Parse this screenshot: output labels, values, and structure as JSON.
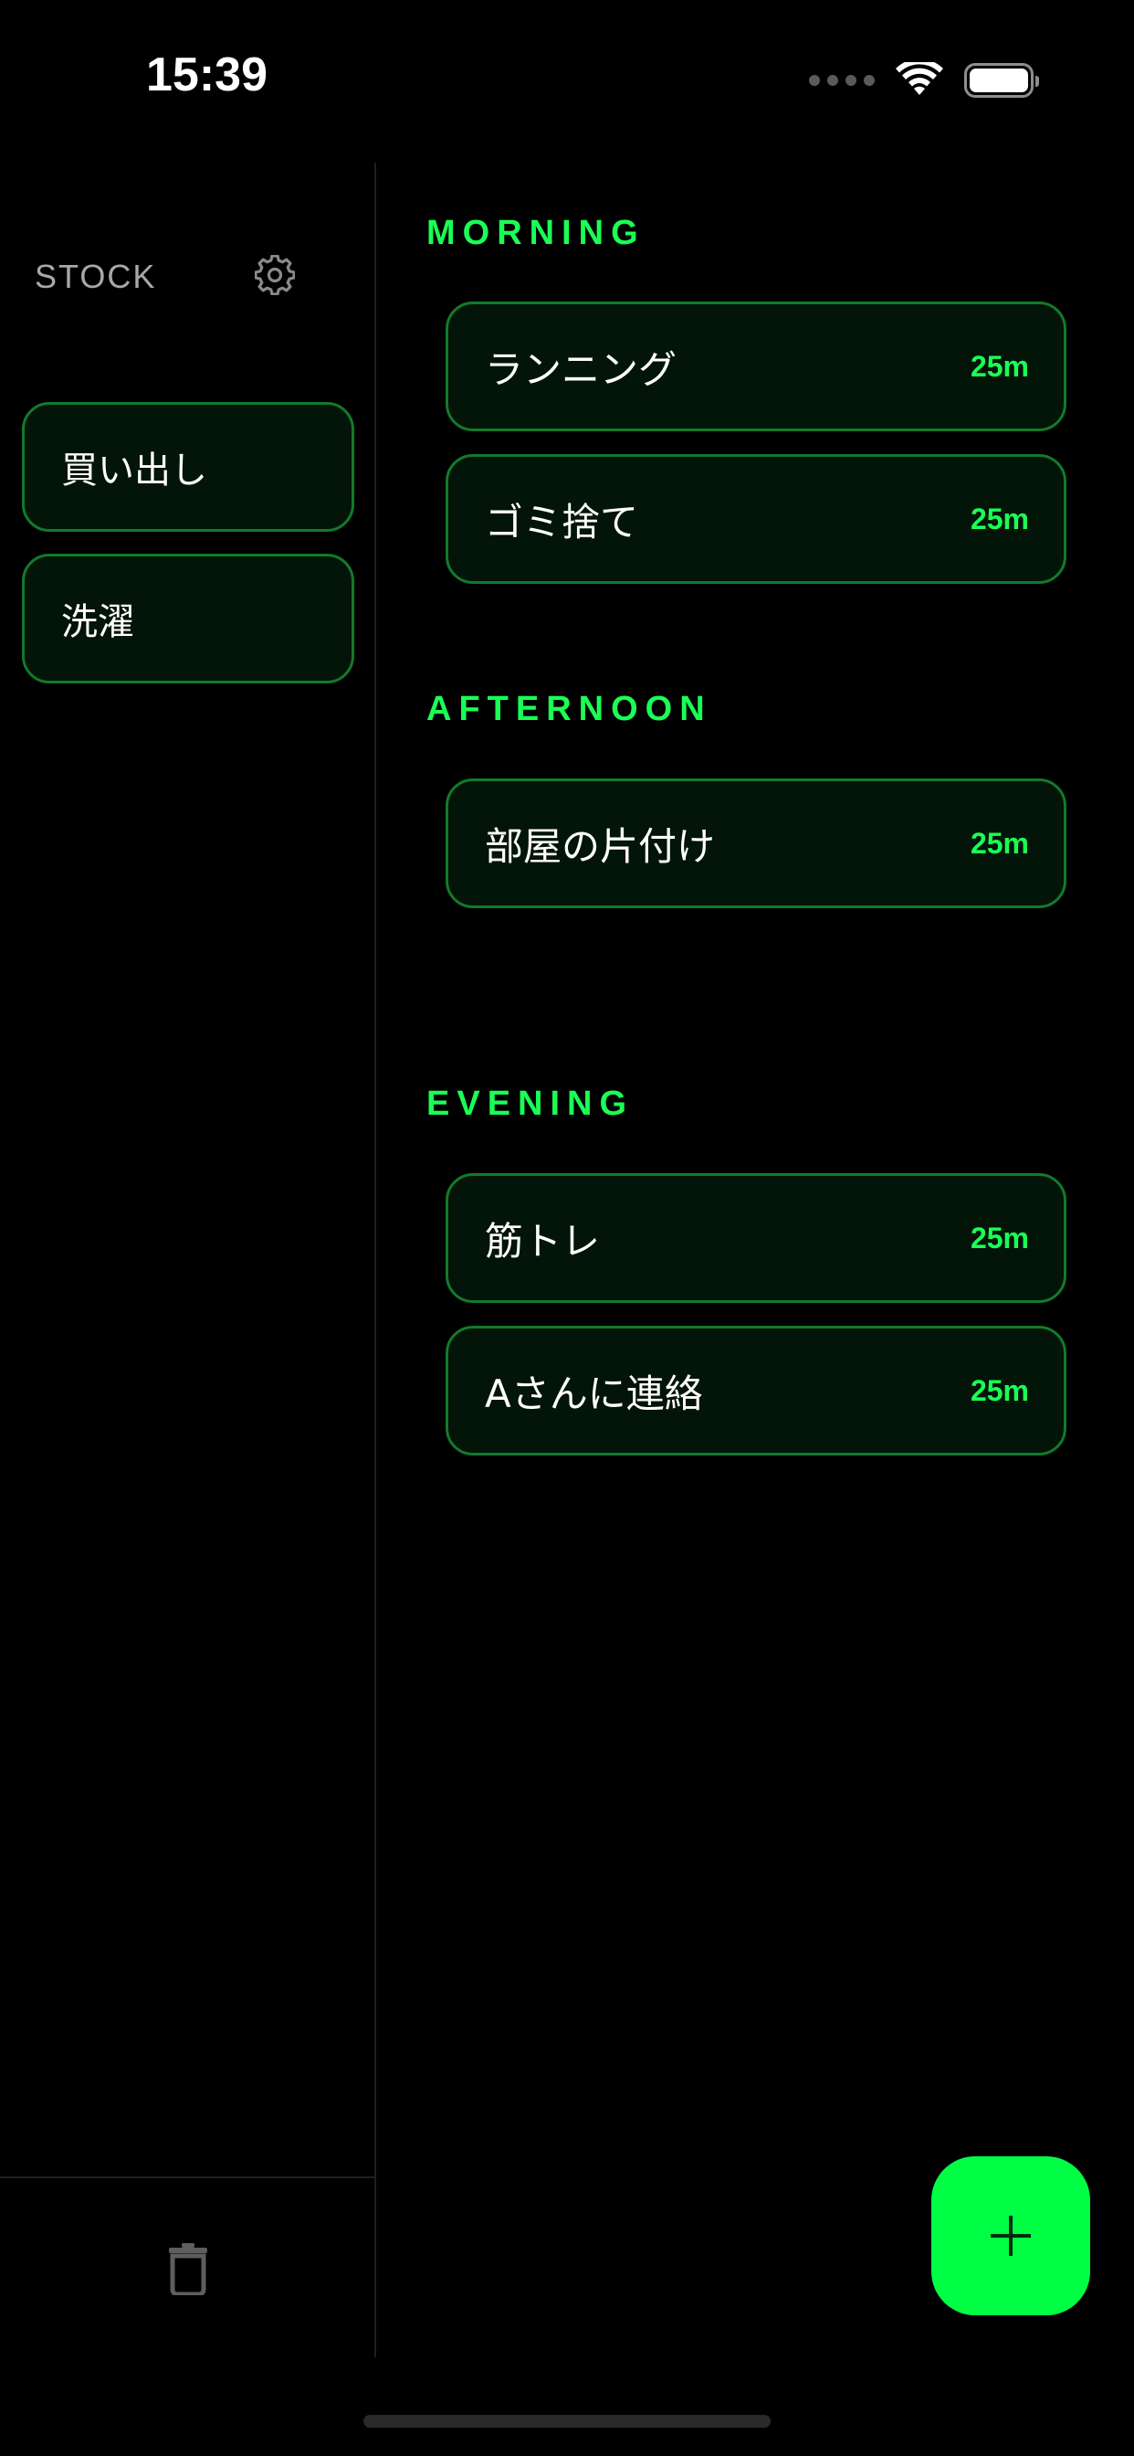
{
  "status_bar": {
    "time": "15:39",
    "icons": [
      "cellular-dots-icon",
      "wifi-icon",
      "battery-icon"
    ]
  },
  "colors": {
    "background": "#000000",
    "accent_green": "#1aff55",
    "fab_green": "#00ff44",
    "card_border": "#127a2c",
    "card_fill": "#031408",
    "muted_text": "#a8a8a8"
  },
  "sidebar": {
    "title": "STOCK",
    "settings_icon": "gear-icon",
    "items": [
      {
        "label": "買い出し"
      },
      {
        "label": "洗濯"
      }
    ],
    "trash_icon": "trash-icon"
  },
  "schedule": {
    "sections": [
      {
        "title": "MORNING",
        "tasks": [
          {
            "label": "ランニング",
            "duration": "25m"
          },
          {
            "label": "ゴミ捨て",
            "duration": "25m"
          }
        ]
      },
      {
        "title": "AFTERNOON",
        "tasks": [
          {
            "label": "部屋の片付け",
            "duration": "25m"
          }
        ]
      },
      {
        "title": "EVENING",
        "tasks": [
          {
            "label": "筋トレ",
            "duration": "25m"
          },
          {
            "label": "Aさんに連絡",
            "duration": "25m"
          }
        ]
      }
    ]
  },
  "fab": {
    "icon": "plus-icon"
  }
}
